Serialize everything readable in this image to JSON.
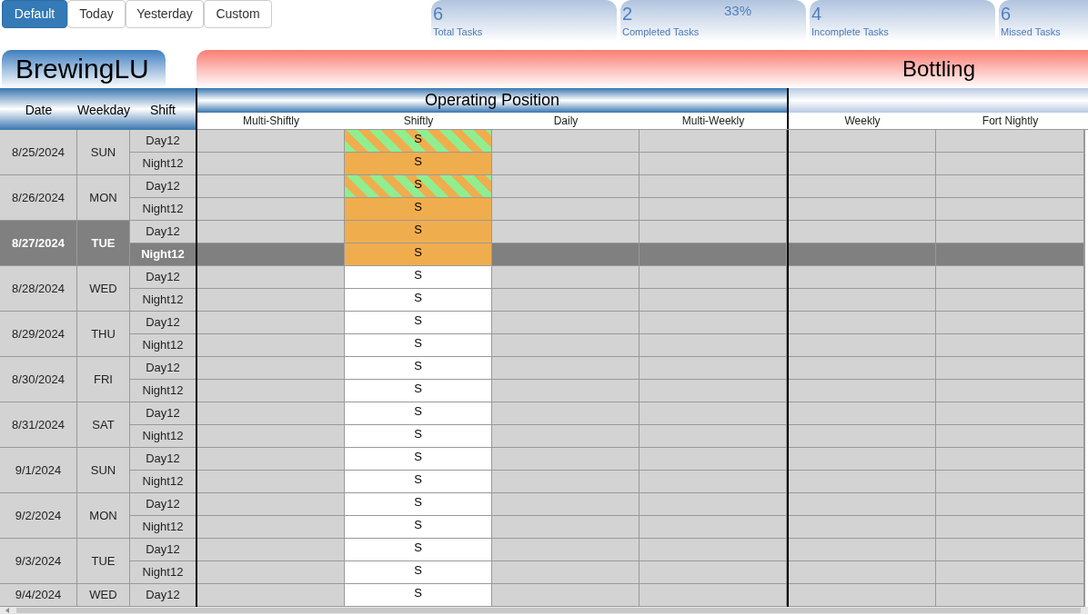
{
  "filters": [
    {
      "label": "Default",
      "selected": true
    },
    {
      "label": "Today",
      "selected": false
    },
    {
      "label": "Yesterday",
      "selected": false
    },
    {
      "label": "Custom",
      "selected": false
    }
  ],
  "stats": [
    {
      "value": "6",
      "label": "Total Tasks"
    },
    {
      "value": "2",
      "label": "Completed Tasks",
      "percent": "33%"
    },
    {
      "value": "4",
      "label": "Incomplete Tasks"
    },
    {
      "value": "6",
      "label": "Missed Tasks"
    }
  ],
  "site": "BrewingLU",
  "area": "Bottling",
  "row_headers": [
    "Date",
    "Weekday",
    "Shift"
  ],
  "group": "Operating Position",
  "columns": [
    "Multi-Shiftly",
    "Shiftly",
    "Daily",
    "Multi-Weekly",
    "Weekly",
    "Fort Nightly"
  ],
  "days": [
    {
      "date": "8/25/2024",
      "weekday": "SUN",
      "selected": false,
      "shifts": [
        {
          "label": "Day12",
          "selected": false,
          "shiftly": {
            "text": "S",
            "kind": "striped"
          }
        },
        {
          "label": "Night12",
          "selected": false,
          "shiftly": {
            "text": "S",
            "kind": "filled"
          }
        }
      ]
    },
    {
      "date": "8/26/2024",
      "weekday": "MON",
      "selected": false,
      "shifts": [
        {
          "label": "Day12",
          "selected": false,
          "shiftly": {
            "text": "S",
            "kind": "striped"
          }
        },
        {
          "label": "Night12",
          "selected": false,
          "shiftly": {
            "text": "S",
            "kind": "filled"
          }
        }
      ]
    },
    {
      "date": "8/27/2024",
      "weekday": "TUE",
      "selected": true,
      "shifts": [
        {
          "label": "Day12",
          "selected": false,
          "shiftly": {
            "text": "S",
            "kind": "filled"
          }
        },
        {
          "label": "Night12",
          "selected": true,
          "shiftly": {
            "text": "S",
            "kind": "filled"
          }
        }
      ]
    },
    {
      "date": "8/28/2024",
      "weekday": "WED",
      "selected": false,
      "shifts": [
        {
          "label": "Day12",
          "selected": false,
          "shiftly": {
            "text": "S",
            "kind": "open"
          }
        },
        {
          "label": "Night12",
          "selected": false,
          "shiftly": {
            "text": "S",
            "kind": "open"
          }
        }
      ]
    },
    {
      "date": "8/29/2024",
      "weekday": "THU",
      "selected": false,
      "shifts": [
        {
          "label": "Day12",
          "selected": false,
          "shiftly": {
            "text": "S",
            "kind": "open"
          }
        },
        {
          "label": "Night12",
          "selected": false,
          "shiftly": {
            "text": "S",
            "kind": "open"
          }
        }
      ]
    },
    {
      "date": "8/30/2024",
      "weekday": "FRI",
      "selected": false,
      "shifts": [
        {
          "label": "Day12",
          "selected": false,
          "shiftly": {
            "text": "S",
            "kind": "open"
          }
        },
        {
          "label": "Night12",
          "selected": false,
          "shiftly": {
            "text": "S",
            "kind": "open"
          }
        }
      ]
    },
    {
      "date": "8/31/2024",
      "weekday": "SAT",
      "selected": false,
      "shifts": [
        {
          "label": "Day12",
          "selected": false,
          "shiftly": {
            "text": "S",
            "kind": "open"
          }
        },
        {
          "label": "Night12",
          "selected": false,
          "shiftly": {
            "text": "S",
            "kind": "open"
          }
        }
      ]
    },
    {
      "date": "9/1/2024",
      "weekday": "SUN",
      "selected": false,
      "shifts": [
        {
          "label": "Day12",
          "selected": false,
          "shiftly": {
            "text": "S",
            "kind": "open"
          }
        },
        {
          "label": "Night12",
          "selected": false,
          "shiftly": {
            "text": "S",
            "kind": "open"
          }
        }
      ]
    },
    {
      "date": "9/2/2024",
      "weekday": "MON",
      "selected": false,
      "shifts": [
        {
          "label": "Day12",
          "selected": false,
          "shiftly": {
            "text": "S",
            "kind": "open"
          }
        },
        {
          "label": "Night12",
          "selected": false,
          "shiftly": {
            "text": "S",
            "kind": "open"
          }
        }
      ]
    },
    {
      "date": "9/3/2024",
      "weekday": "TUE",
      "selected": false,
      "shifts": [
        {
          "label": "Day12",
          "selected": false,
          "shiftly": {
            "text": "S",
            "kind": "open"
          }
        },
        {
          "label": "Night12",
          "selected": false,
          "shiftly": {
            "text": "S",
            "kind": "open"
          }
        }
      ]
    },
    {
      "date": "9/4/2024",
      "weekday": "WED",
      "selected": false,
      "shifts": [
        {
          "label": "Day12",
          "selected": false,
          "shiftly": {
            "text": "S",
            "kind": "open"
          }
        }
      ]
    }
  ]
}
